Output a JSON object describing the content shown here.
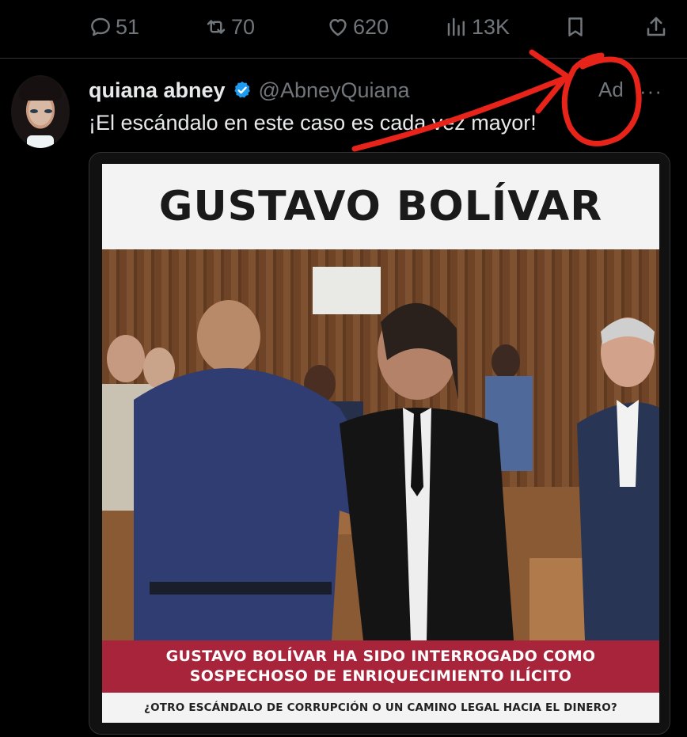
{
  "actions": {
    "replies": "51",
    "reposts": "70",
    "likes": "620",
    "views": "13K"
  },
  "tweet": {
    "display_name": "quiana abney",
    "handle": "@AbneyQuiana",
    "ad_label": "Ad",
    "more_label": "···",
    "text": "¡El escándalo en este caso es cada vez mayor!"
  },
  "poster": {
    "title": "GUSTAVO BOLÍVAR",
    "caption_line1": "GUSTAVO BOLÍVAR HA SIDO INTERROGADO COMO",
    "caption_line2": "SOSPECHOSO DE ENRIQUECIMIENTO ILÍCITO",
    "subcaption": "¿OTRO ESCÁNDALO DE CORRUPCIÓN O UN CAMINO LEGAL HACIA EL DINERO?"
  },
  "colors": {
    "background": "#000000",
    "text_primary": "#e7e9ea",
    "text_secondary": "#71767b",
    "verified_blue": "#1d9bf0",
    "annotation_red": "#e8231a",
    "poster_banner": "#a8243b"
  },
  "icons": [
    "reply-icon",
    "repost-icon",
    "like-icon",
    "views-icon",
    "bookmark-icon",
    "share-icon",
    "verified-badge-icon"
  ]
}
